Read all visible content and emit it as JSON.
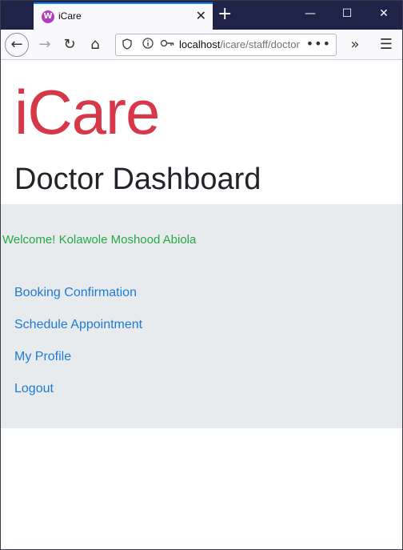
{
  "browser": {
    "tab_title": "iCare",
    "favicon_letter": "W",
    "url_host": "localhost",
    "url_path": "/icare/staff/doctor",
    "new_tab": "+",
    "tab_close": "✕",
    "url_menu": "•••",
    "back": "←",
    "forward": "→",
    "reload": "↻",
    "home": "⌂",
    "overflow": "»",
    "menu": "☰",
    "minimize": "—",
    "maximize": "☐",
    "close": "✕"
  },
  "page": {
    "brand": "iCare",
    "title": "Doctor Dashboard",
    "welcome": "Welcome! Kolawole Moshood Abiola",
    "nav": [
      {
        "label": "Booking Confirmation"
      },
      {
        "label": "Schedule Appointment"
      },
      {
        "label": "My Profile"
      },
      {
        "label": "Logout"
      }
    ]
  },
  "colors": {
    "brand": "#d6384a",
    "welcome": "#28a745",
    "link": "#1e7bd4",
    "panel_bg": "#e8ebee"
  }
}
